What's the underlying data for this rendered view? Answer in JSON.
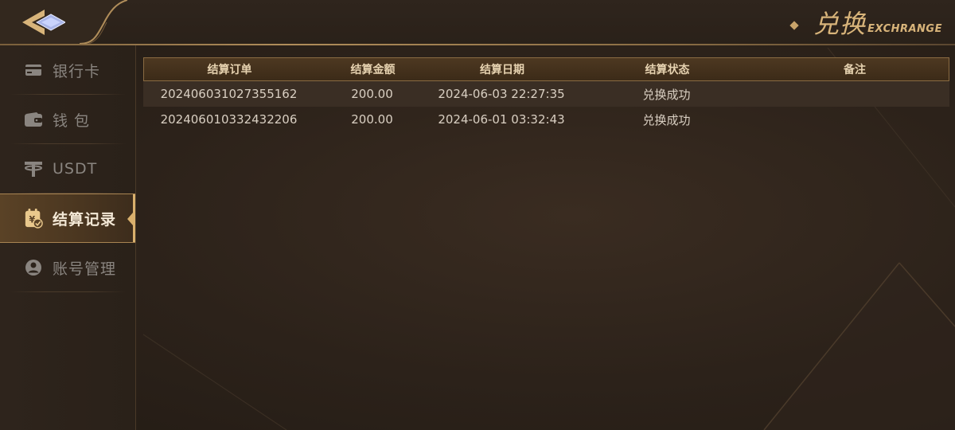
{
  "header": {
    "title_cn": "兑换",
    "title_en": "EXCHRANGE"
  },
  "sidebar": {
    "items": [
      {
        "label": "银行卡",
        "icon": "bank-card-icon",
        "active": false
      },
      {
        "label": "钱 包",
        "icon": "wallet-icon",
        "active": false
      },
      {
        "label": "USDT",
        "icon": "tether-icon",
        "active": false
      },
      {
        "label": "结算记录",
        "icon": "settlement-record-icon",
        "active": true
      },
      {
        "label": "账号管理",
        "icon": "user-account-icon",
        "active": false
      }
    ]
  },
  "table": {
    "headers": [
      "结算订单",
      "结算金额",
      "结算日期",
      "结算状态",
      "备注"
    ],
    "rows": [
      [
        "202406031027355162",
        "200.00",
        "2024-06-03 22:27:35",
        "兑换成功",
        ""
      ],
      [
        "202406010332432206",
        "200.00",
        "2024-06-01 03:32:43",
        "兑换成功",
        ""
      ]
    ]
  },
  "colors": {
    "accent_gold": "#d9b06d",
    "background": "#2a2119",
    "active_tab": "#4a3620"
  }
}
